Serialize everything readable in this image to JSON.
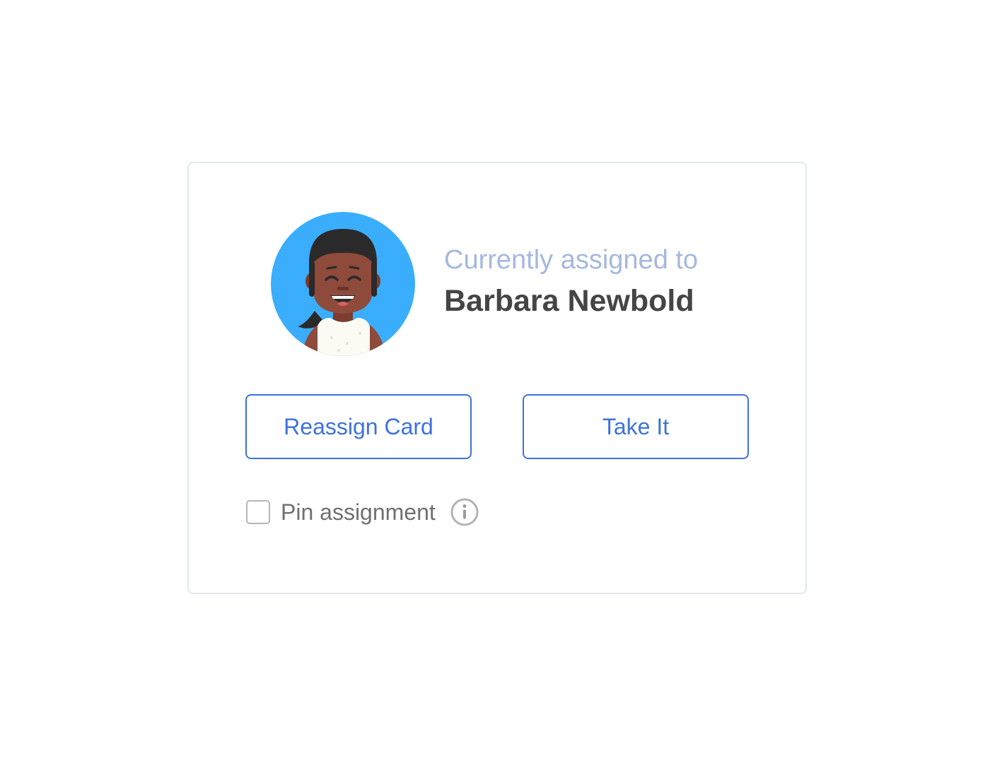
{
  "assignment": {
    "label": "Currently assigned to",
    "assignee_name": "Barbara Newbold",
    "avatar_icon": "user-avatar-illustration",
    "avatar_background": "#3aaefc"
  },
  "actions": {
    "reassign_label": "Reassign Card",
    "take_label": "Take It"
  },
  "pin": {
    "label": "Pin assignment",
    "checked": false,
    "info_icon": "info-icon"
  },
  "colors": {
    "accent": "#3e72db",
    "label": "#a6b8de",
    "name": "#454545",
    "border": "#e3e8f0"
  }
}
